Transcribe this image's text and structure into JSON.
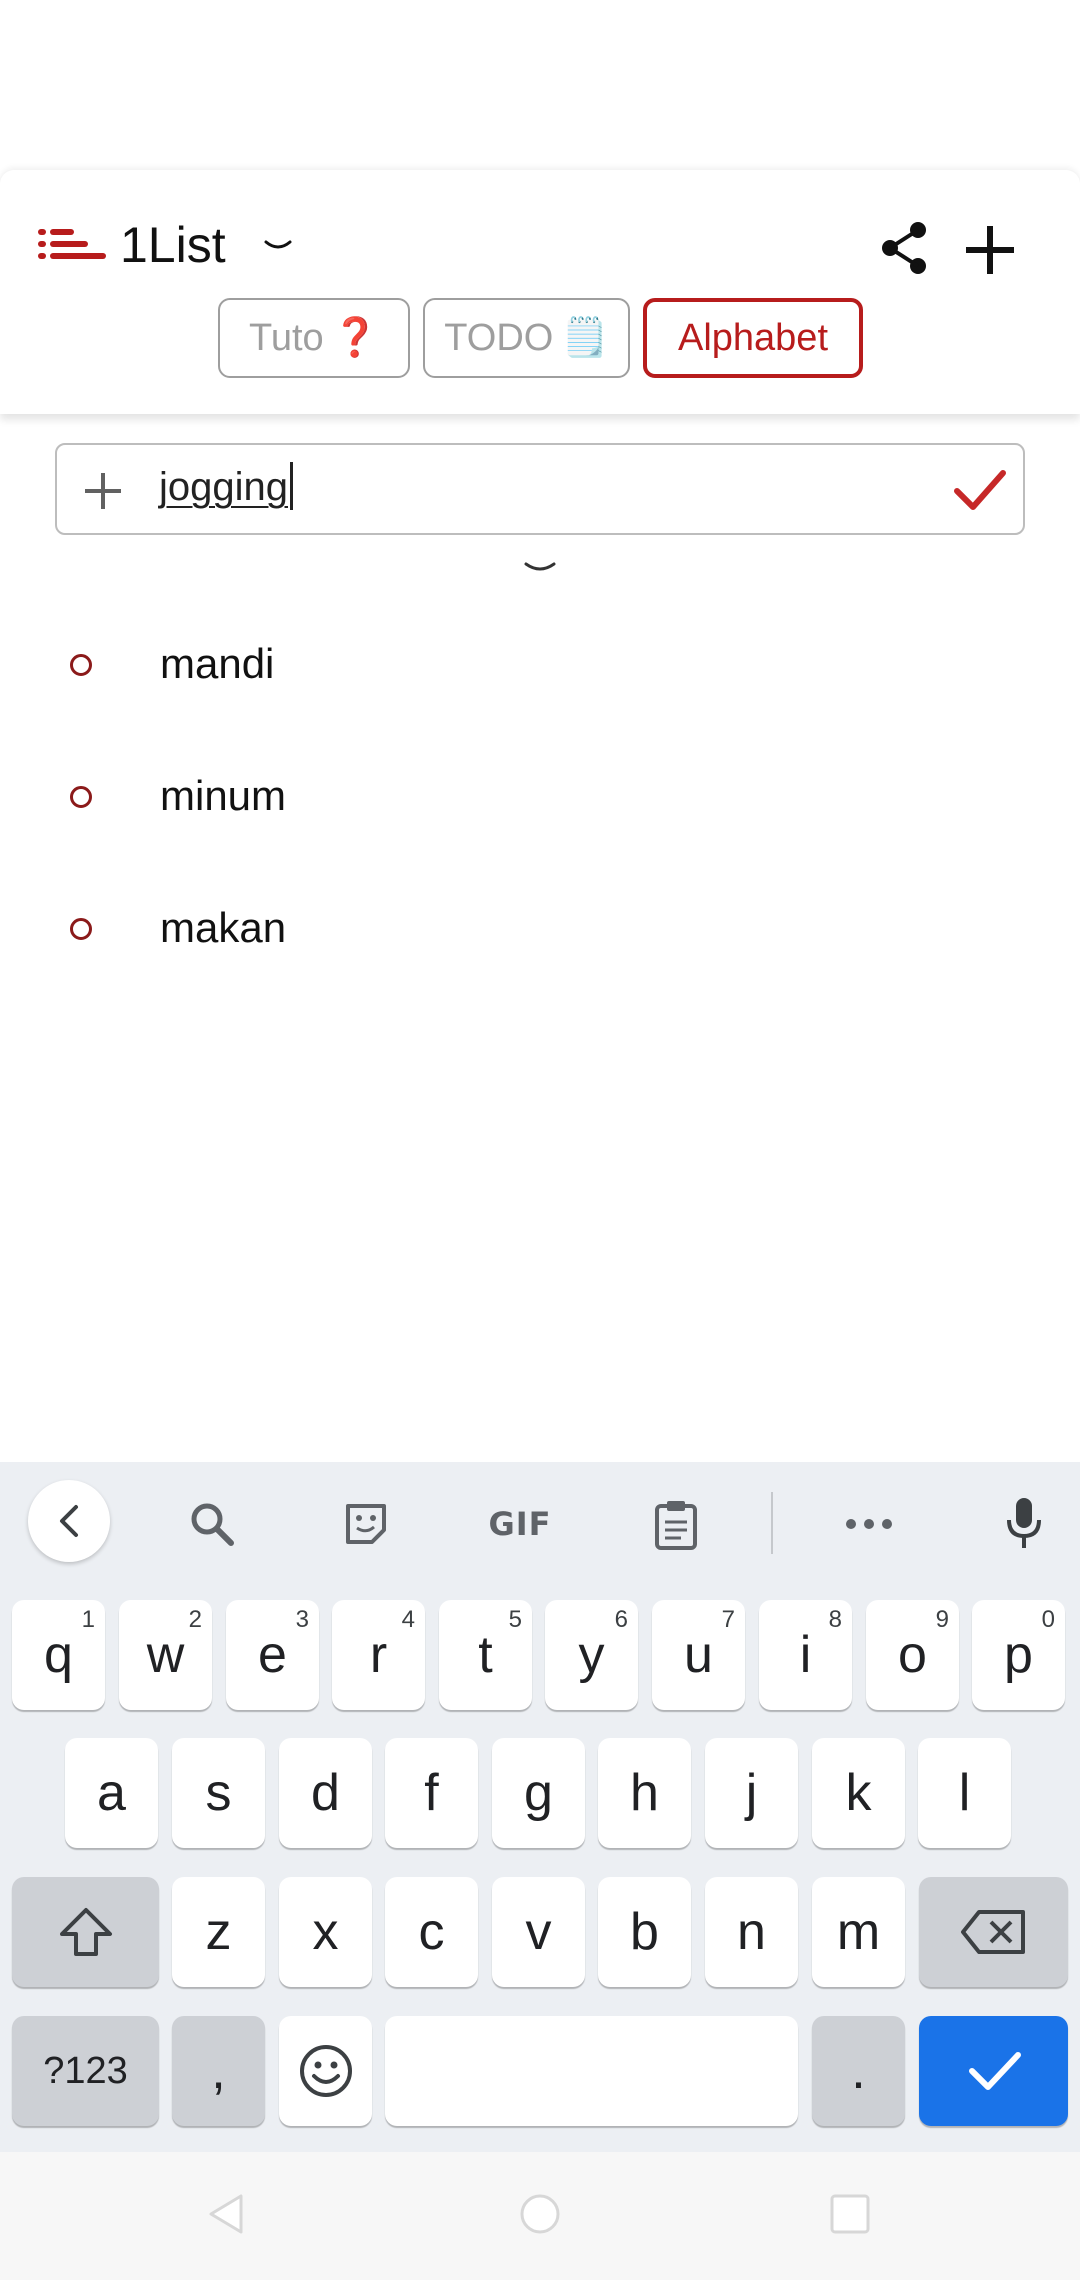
{
  "header": {
    "title": "1List",
    "brand_color": "#b71c1c"
  },
  "tabs": [
    {
      "label": "Tuto",
      "emoji": "❓",
      "active": false
    },
    {
      "label": "TODO",
      "emoji": "🗒️",
      "active": false
    },
    {
      "label": "Alphabet",
      "emoji": "",
      "active": true
    }
  ],
  "input": {
    "value": "jogging"
  },
  "items": [
    {
      "label": "mandi"
    },
    {
      "label": "minum"
    },
    {
      "label": "makan"
    }
  ],
  "keyboard": {
    "toolbar": {
      "gif_label": "GIF"
    },
    "row1": [
      {
        "key": "q",
        "hint": "1"
      },
      {
        "key": "w",
        "hint": "2"
      },
      {
        "key": "e",
        "hint": "3"
      },
      {
        "key": "r",
        "hint": "4"
      },
      {
        "key": "t",
        "hint": "5"
      },
      {
        "key": "y",
        "hint": "6"
      },
      {
        "key": "u",
        "hint": "7"
      },
      {
        "key": "i",
        "hint": "8"
      },
      {
        "key": "o",
        "hint": "9"
      },
      {
        "key": "p",
        "hint": "0"
      }
    ],
    "row2": [
      "a",
      "s",
      "d",
      "f",
      "g",
      "h",
      "j",
      "k",
      "l"
    ],
    "row3": [
      "z",
      "x",
      "c",
      "v",
      "b",
      "n",
      "m"
    ],
    "symbols_label": "?123",
    "comma": ",",
    "period": ".",
    "enter_color": "#1a73e8"
  }
}
